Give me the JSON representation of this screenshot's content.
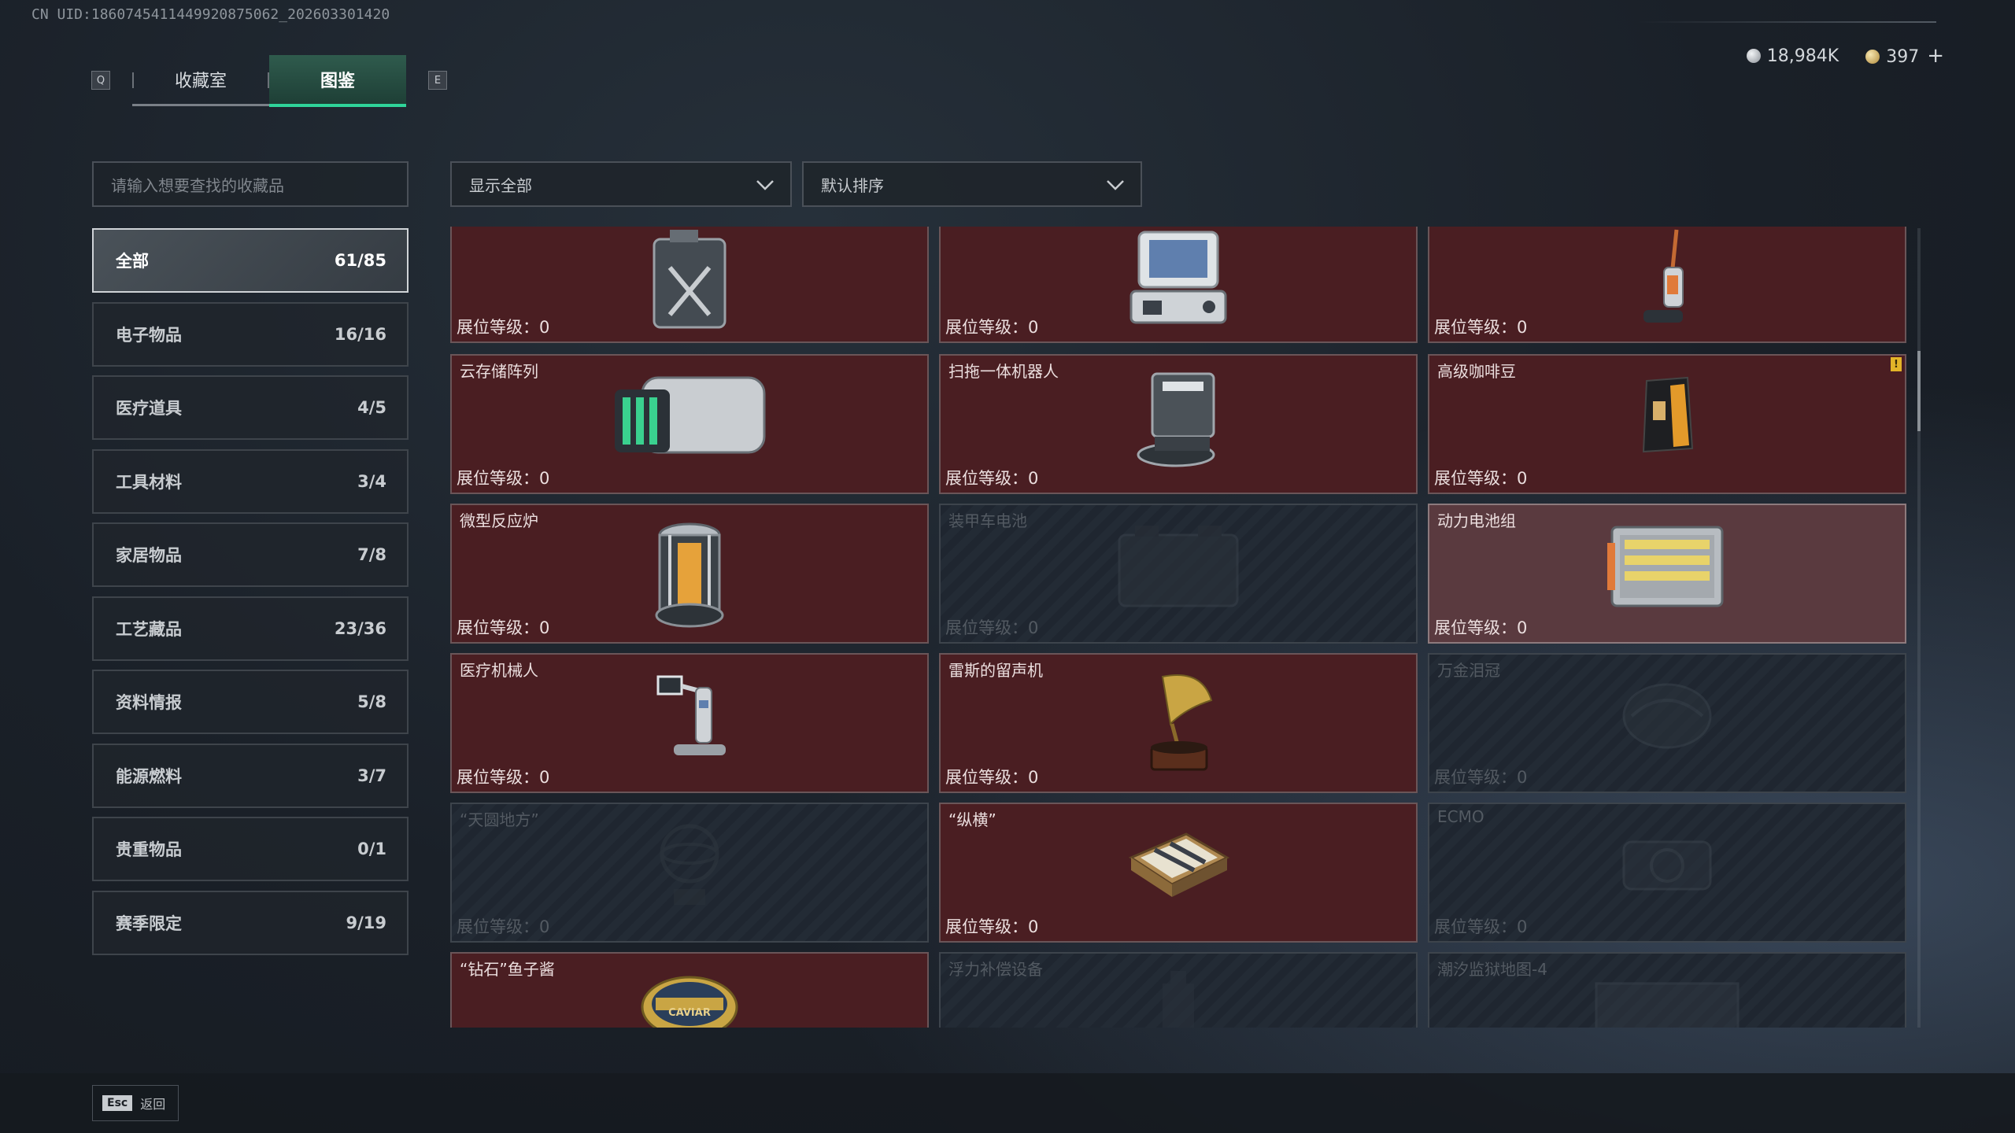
{
  "uid_text": "CN UID:1860745411449920875062_202603301420",
  "tabs": {
    "left_key": "Q",
    "right_key": "E",
    "items": [
      {
        "label": "收藏室"
      },
      {
        "label": "图鉴"
      }
    ]
  },
  "currency": {
    "silver": "18,984K",
    "gold": "397",
    "plus": "+"
  },
  "search": {
    "placeholder": "请输入想要查找的收藏品"
  },
  "filter": {
    "selected": "显示全部"
  },
  "sort": {
    "selected": "默认排序"
  },
  "categories": [
    {
      "label": "全部",
      "count": "61/85"
    },
    {
      "label": "电子物品",
      "count": "16/16"
    },
    {
      "label": "医疗道具",
      "count": "4/5"
    },
    {
      "label": "工具材料",
      "count": "3/4"
    },
    {
      "label": "家居物品",
      "count": "7/8"
    },
    {
      "label": "工艺藏品",
      "count": "23/36"
    },
    {
      "label": "资料情报",
      "count": "5/8"
    },
    {
      "label": "能源燃料",
      "count": "3/7"
    },
    {
      "label": "贵重物品",
      "count": "0/1"
    },
    {
      "label": "赛季限定",
      "count": "9/19"
    }
  ],
  "items": [
    {
      "name": "",
      "level": "展位等级：0",
      "state": "owned",
      "icon": "fuel-can-icon"
    },
    {
      "name": "",
      "level": "展位等级：0",
      "state": "owned",
      "icon": "computer-terminal-icon"
    },
    {
      "name": "",
      "level": "展位等级：0",
      "state": "owned",
      "icon": "floor-scrubber-icon"
    },
    {
      "name": "云存储阵列",
      "level": "展位等级：0",
      "state": "owned",
      "icon": "storage-array-icon"
    },
    {
      "name": "扫拖一体机器人",
      "level": "展位等级：0",
      "state": "owned",
      "icon": "robot-vacuum-icon"
    },
    {
      "name": "高级咖啡豆",
      "level": "展位等级：0",
      "state": "owned",
      "icon": "coffee-bag-icon",
      "badge": "!"
    },
    {
      "name": "微型反应炉",
      "level": "展位等级：0",
      "state": "owned",
      "icon": "reactor-icon"
    },
    {
      "name": "装甲车电池",
      "level": "展位等级：0",
      "state": "locked",
      "icon": "vehicle-battery-icon"
    },
    {
      "name": "动力电池组",
      "level": "展位等级：0",
      "state": "highlight",
      "icon": "battery-pack-icon"
    },
    {
      "name": "医疗机械人",
      "level": "展位等级：0",
      "state": "owned",
      "icon": "medical-robot-icon"
    },
    {
      "name": "雷斯的留声机",
      "level": "展位等级：0",
      "state": "owned",
      "icon": "gramophone-icon"
    },
    {
      "name": "万金泪冠",
      "level": "展位等级：0",
      "state": "locked",
      "icon": "crown-icon"
    },
    {
      "name": "“天圆地方”",
      "level": "展位等级：0",
      "state": "locked",
      "icon": "armillary-icon"
    },
    {
      "name": "“纵横”",
      "level": "展位等级：0",
      "state": "owned",
      "icon": "chess-board-icon"
    },
    {
      "name": "ECMO",
      "level": "展位等级：0",
      "state": "locked",
      "icon": "ecmo-icon"
    },
    {
      "name": "“钻石”鱼子酱",
      "level": "",
      "state": "owned",
      "icon": "caviar-tin-icon",
      "caviar_label": "CAVIAR"
    },
    {
      "name": "浮力补偿设备",
      "level": "",
      "state": "locked",
      "icon": "buoyancy-device-icon"
    },
    {
      "name": "潮汐监狱地图-4",
      "level": "",
      "state": "locked",
      "icon": "map-icon"
    }
  ],
  "footer": {
    "key": "Esc",
    "label": "返回"
  }
}
